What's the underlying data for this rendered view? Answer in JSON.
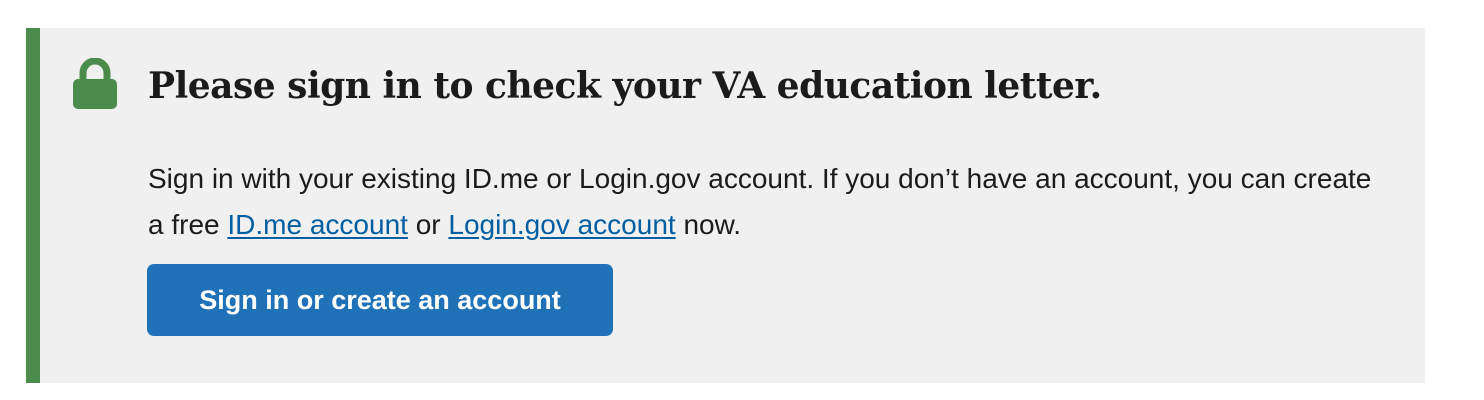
{
  "alert": {
    "accent_color": "#4b8b4b",
    "icon": "lock-icon",
    "heading": "Please sign in to check your VA education letter.",
    "body": {
      "text_before": "Sign in with your existing ID.me or Login.gov account. If you don’t have an account, you can create a free ",
      "link_idme": "ID.me account",
      "text_middle": " or ",
      "link_logingov": "Login.gov account",
      "text_after": " now."
    },
    "button_label": "Sign in or create an account",
    "button_color": "#1f72b8"
  }
}
